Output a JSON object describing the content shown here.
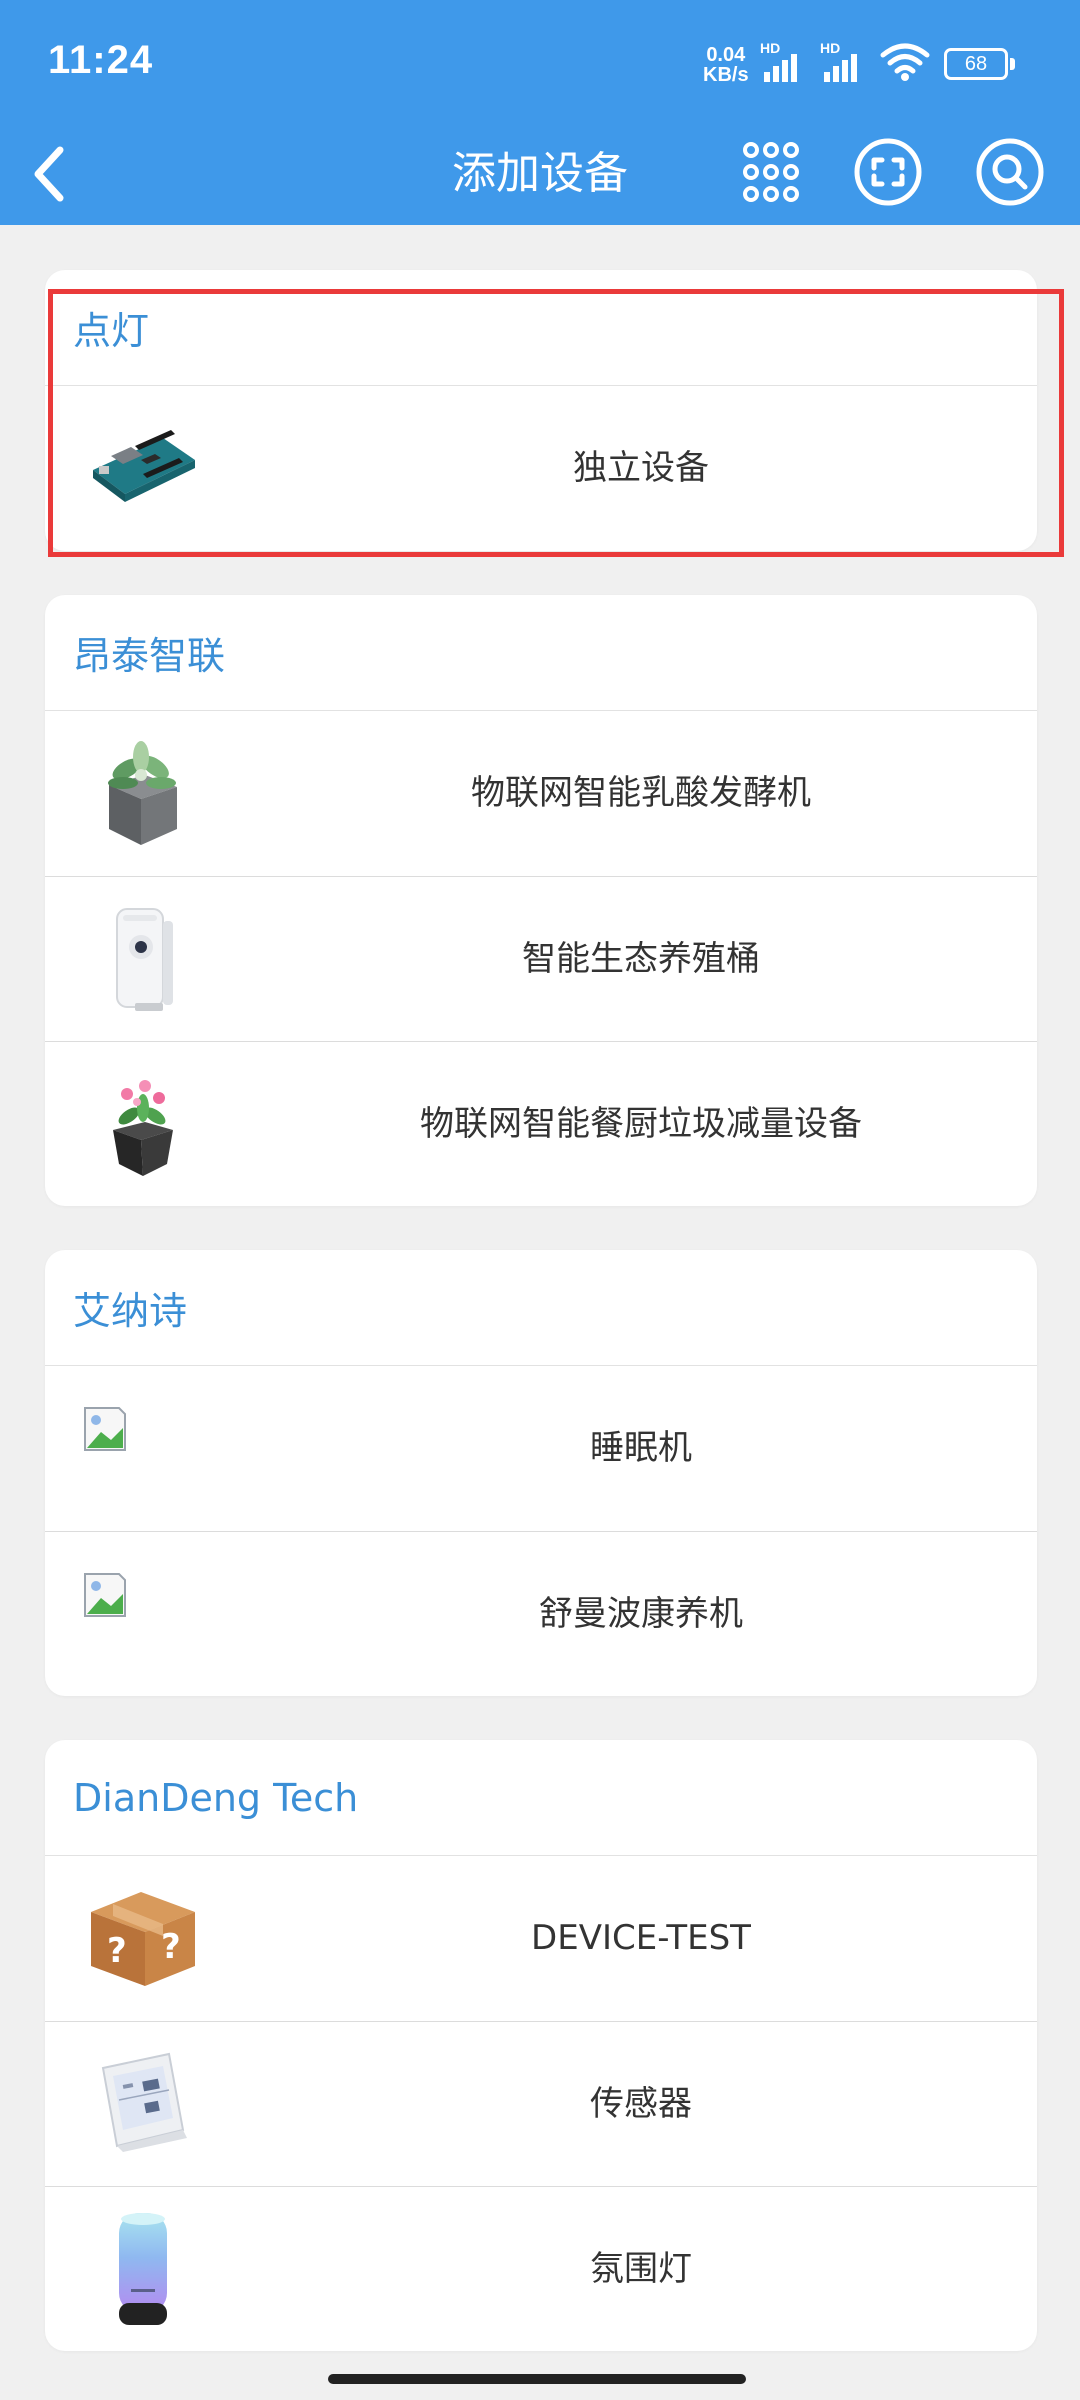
{
  "status_bar": {
    "time": "11:24",
    "net_speed_value": "0.04",
    "net_speed_unit": "KB/s",
    "signal_1_tag": "HD",
    "signal_2_tag": "HD",
    "battery_level": "68"
  },
  "header": {
    "title": "添加设备"
  },
  "colors": {
    "primary": "#3f99ea",
    "group_title": "#3b8fd6",
    "highlight": "#ea3a3a",
    "background": "#f0f0f0"
  },
  "groups": [
    {
      "title": "点灯",
      "items": [
        {
          "label": "独立设备",
          "icon": "arduino-board-icon"
        }
      ]
    },
    {
      "title": "昂泰智联",
      "items": [
        {
          "label": "物联网智能乳酸发酵机",
          "icon": "potted-plant-icon"
        },
        {
          "label": "智能生态养殖桶",
          "icon": "air-purifier-icon"
        },
        {
          "label": "物联网智能餐厨垃圾减量设备",
          "icon": "flower-pot-icon"
        }
      ]
    },
    {
      "title": "艾纳诗",
      "items": [
        {
          "label": "睡眠机",
          "icon": "broken-image-icon"
        },
        {
          "label": "舒曼波康养机",
          "icon": "broken-image-icon"
        }
      ]
    },
    {
      "title": "DianDeng Tech",
      "items": [
        {
          "label": "DEVICE-TEST",
          "icon": "mystery-box-icon"
        },
        {
          "label": "传感器",
          "icon": "thermo-hygrometer-icon"
        },
        {
          "label": "氛围灯",
          "icon": "ambient-lamp-icon"
        }
      ]
    }
  ]
}
